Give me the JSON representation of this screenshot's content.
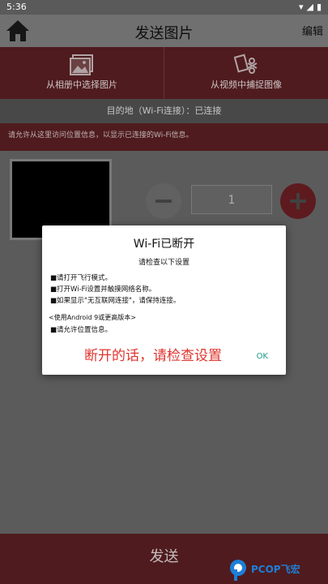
{
  "status": {
    "time": "5:36"
  },
  "header": {
    "title": "发送图片",
    "edit_label": "编辑"
  },
  "actions": [
    {
      "label": "从相册中选择图片"
    },
    {
      "label": "从视频中捕捉图像"
    }
  ],
  "destination": "目的地（Wi-Fi连接）：已连接",
  "permission_text": "请允许从这里访问位置信息，以显示已连接的Wi-Fi信息。",
  "quantity": "1",
  "send_label": "发送",
  "dialog": {
    "title": "Wi-Fi已断开",
    "subtitle": "请检查以下设置",
    "items": [
      "■请打开飞行模式。",
      "■打开Wi-Fi设置并触摸网络名称。",
      "■如果显示\"无互联网连接\"，请保持连接。"
    ],
    "note": "<使用Android 9或更高版本>",
    "note_item": "■请允许位置信息。",
    "red_note": "断开的话，请检查设置",
    "ok_label": "OK"
  },
  "watermark": "PCOP飞宏",
  "colors": {
    "accent_red": "#5b1f23",
    "ok_teal": "#1f9a8a",
    "note_red": "#e0352f"
  }
}
